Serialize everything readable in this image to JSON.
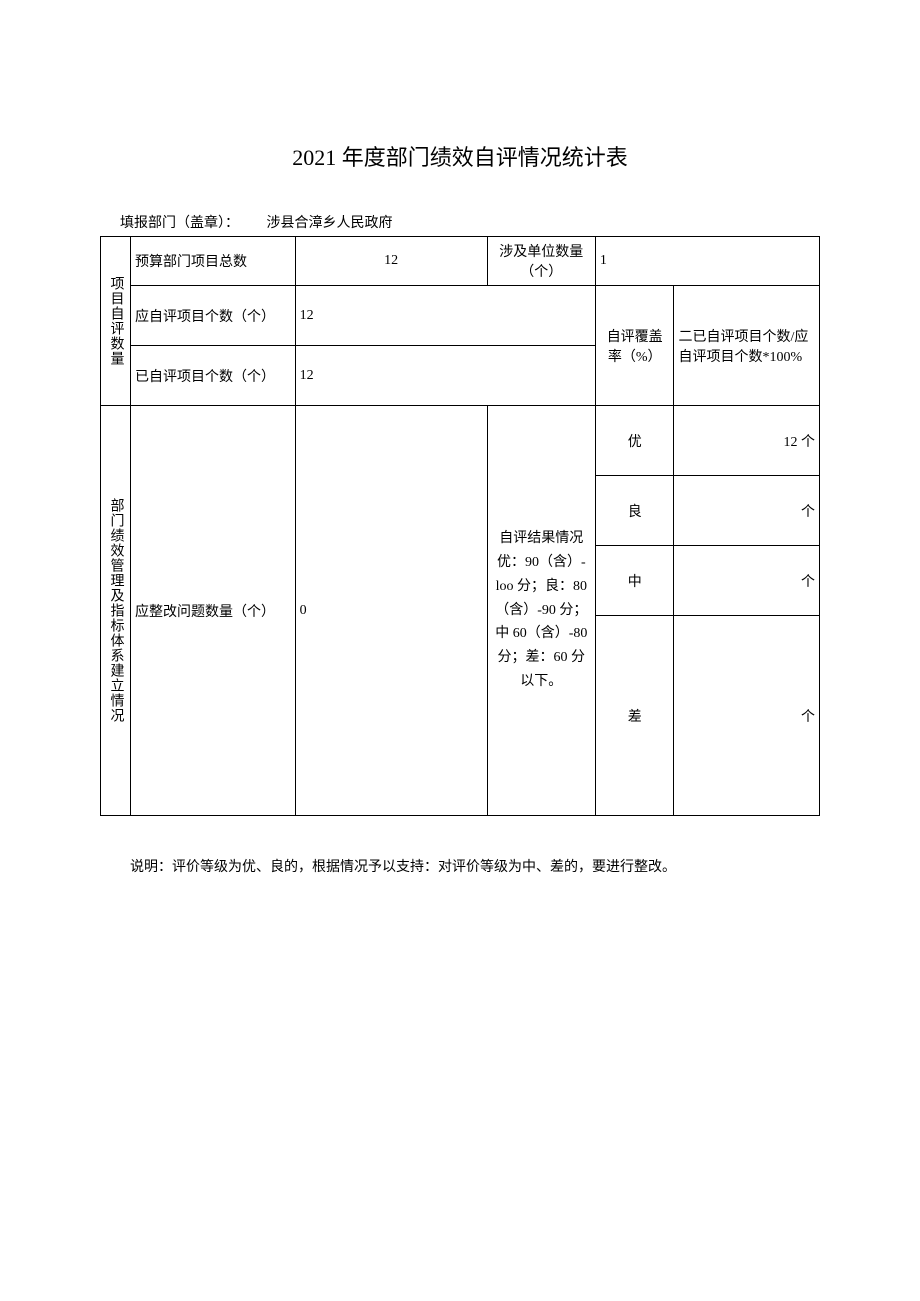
{
  "title": "2021 年度部门绩效自评情况统计表",
  "meta": {
    "label": "填报部门（盖章）：",
    "value": "涉县合漳乡人民政府"
  },
  "section1": {
    "vlabel": "项目自评数量",
    "row1": {
      "label": "预算部门项目总数",
      "value": "12",
      "units_label": "涉及单位数量（个）",
      "units_value": "1"
    },
    "row2": {
      "label": "应自评项目个数（个）",
      "value": "12"
    },
    "row3": {
      "label": "已自评项目个数（个）",
      "value": "12"
    },
    "coverage_label": "自评覆盖率（%）",
    "coverage_formula": "二已自评项目个数/应自评项目个数*100%"
  },
  "section2": {
    "vlabel": "部门绩效管理及指标体系建立情况",
    "rectify_label": "应整改问题数量（个）",
    "rectify_value": "0",
    "criteria": "自评结果情况 优：90（含）- loo 分；良：80（含）-90 分；中 60（含）-80 分；差：60 分以下。",
    "grades": {
      "you": {
        "label": "优",
        "value": "12 个"
      },
      "liang": {
        "label": "良",
        "value": "个"
      },
      "zhong": {
        "label": "中",
        "value": "个"
      },
      "cha": {
        "label": "差",
        "value": "个"
      }
    }
  },
  "footer": "说明：评价等级为优、良的，根据情况予以支持：对评价等级为中、差的，要进行整改。"
}
